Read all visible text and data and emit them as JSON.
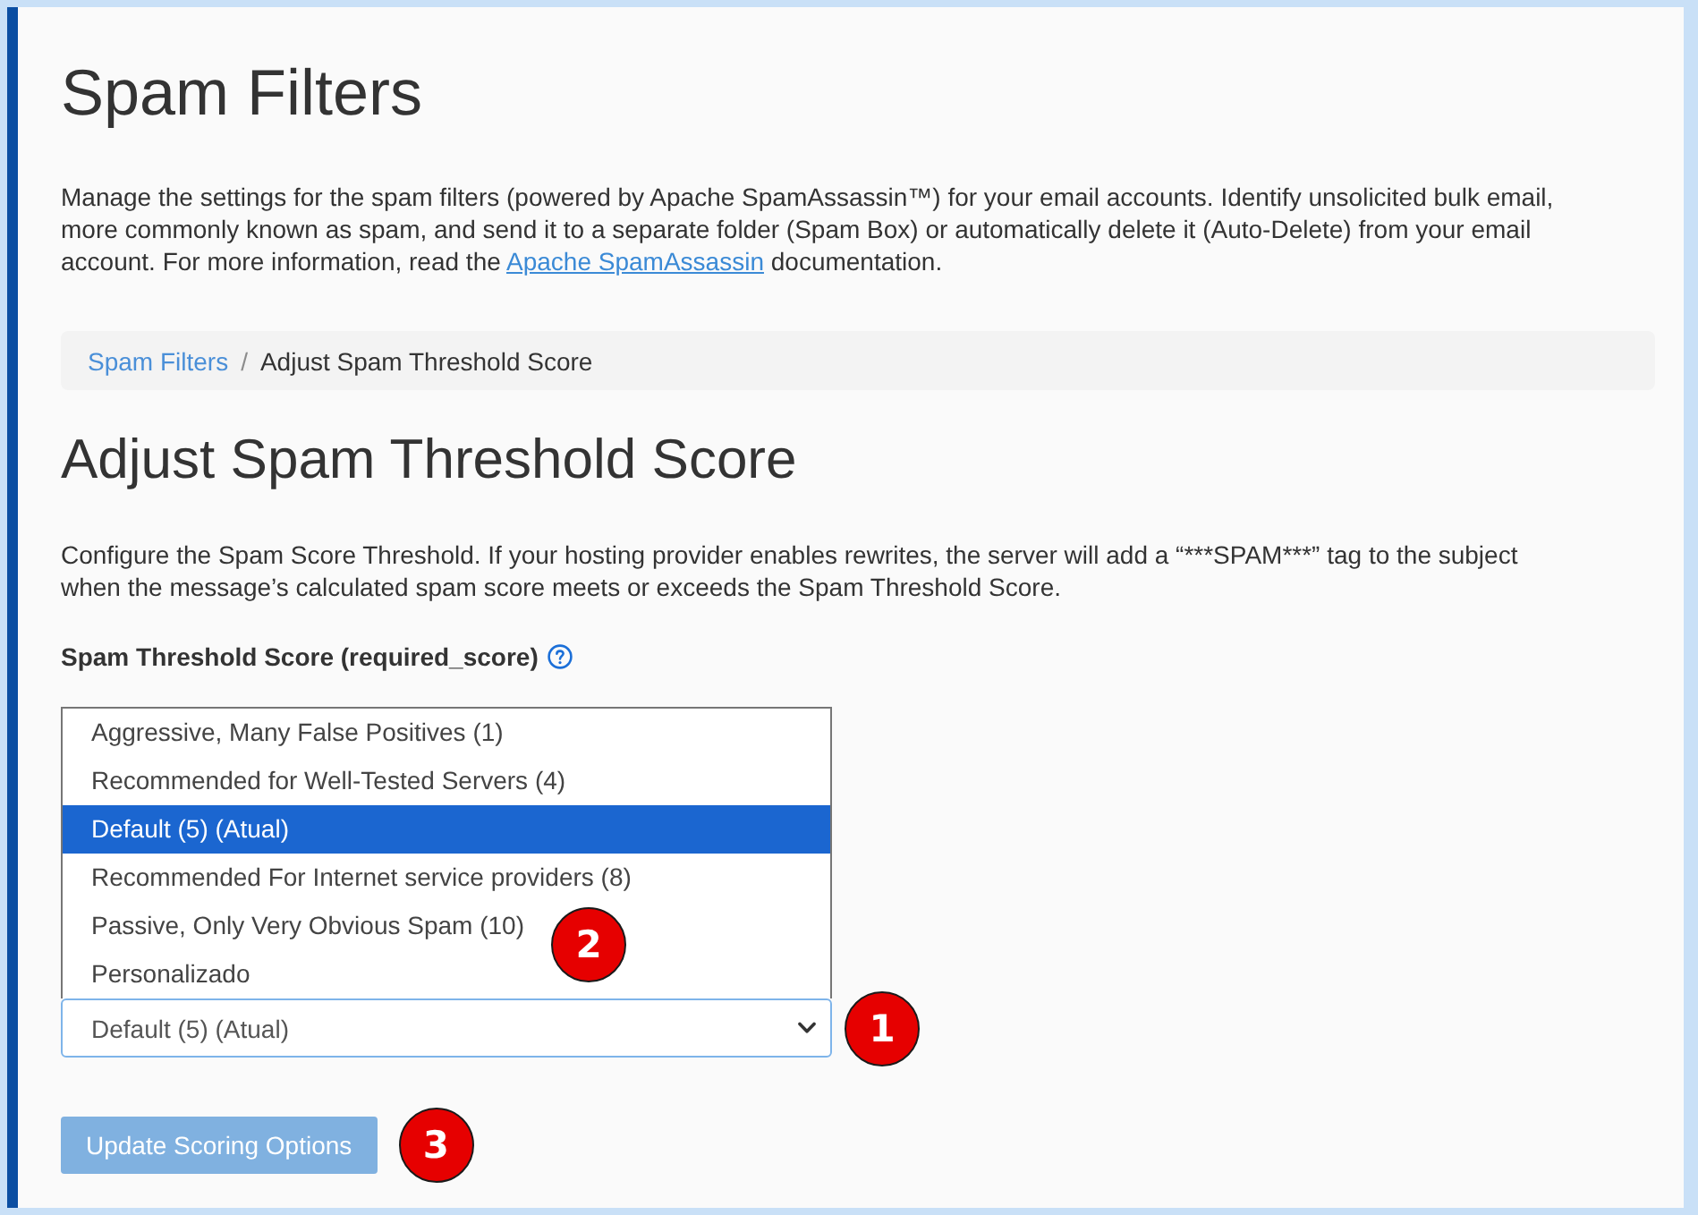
{
  "page": {
    "title": "Spam Filters",
    "intro": {
      "text": "Manage the settings for the spam filters (powered by Apache SpamAssassin™) for your email accounts. Identify unsolicited bulk email, more commonly known as spam, and send it to a separate folder (Spam Box) or automatically delete it (Auto-Delete) from your email account. For more information, read the ",
      "link": "Apache SpamAssassin",
      "text_after": " documentation."
    }
  },
  "breadcrumb": {
    "separator": "/",
    "items": [
      {
        "label": "Spam Filters",
        "kind": "link"
      },
      {
        "label": "Adjust Spam Threshold Score",
        "kind": "current"
      }
    ]
  },
  "section": {
    "title": "Adjust Spam Threshold Score",
    "description": "Configure the Spam Score Threshold. If your hosting provider enables rewrites, the server will add a “***SPAM***” tag to the subject when the message’s calculated spam score meets or exceeds the Spam Threshold Score."
  },
  "field": {
    "label": "Spam Threshold Score (required_score)",
    "help_icon": true
  },
  "select": {
    "value": "Default (5) (Atual)",
    "expanded": true,
    "marker": "1",
    "list_marker": "2",
    "options": [
      {
        "label": "Aggressive, Many False Positives (1)",
        "selected": false
      },
      {
        "label": "Recommended for Well-Tested Servers (4)",
        "selected": false
      },
      {
        "label": "Default (5) (Atual)",
        "selected": true
      },
      {
        "label": "Recommended For Internet service providers (8)",
        "selected": false
      },
      {
        "label": "Passive, Only Very Obvious Spam (10)",
        "selected": false
      },
      {
        "label": "Personalizado",
        "selected": false
      }
    ]
  },
  "button": {
    "label": "Update Scoring Options",
    "disabled": true,
    "marker": "3"
  }
}
